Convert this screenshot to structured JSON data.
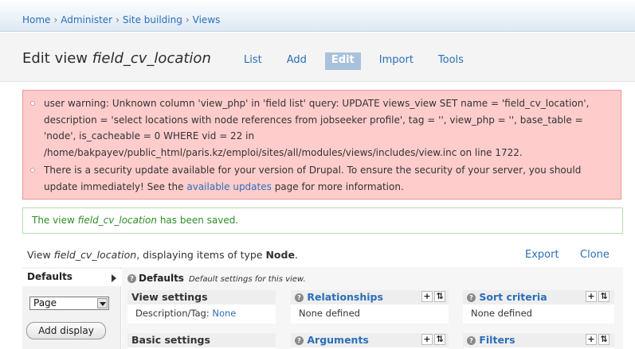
{
  "breadcrumb": [
    "Home",
    "Administer",
    "Site building",
    "Views"
  ],
  "breadcrumb_sep": "›",
  "header": {
    "title_prefix": "Edit view ",
    "title_view_name": "field_cv_location",
    "tabs": [
      "List",
      "Add",
      "Edit",
      "Import",
      "Tools"
    ],
    "active_tab": "Edit"
  },
  "errors": {
    "warning": "user warning: Unknown column 'view_php' in 'field list' query: UPDATE views_view SET name = 'field_cv_location', description = 'select locations with node references from jobseeker profile', tag = '', view_php = '', base_table = 'node', is_cacheable = 0 WHERE vid = 22 in /home/bakpayev/public_html/paris.kz/emploi/sites/all/modules/views/includes/view.inc on line 1722.",
    "security_pre": "There is a security update available for your version of Drupal. To ensure the security of your server, you should update immediately! See the ",
    "security_link": "available updates",
    "security_post": " page for more information."
  },
  "status": {
    "pre": "The view ",
    "view_name": "field_cv_location",
    "post": " has been saved."
  },
  "view_info": {
    "pre": "View ",
    "view_name": "field_cv_location",
    "mid": ", displaying items of type ",
    "type": "Node",
    "post": "."
  },
  "actions": {
    "export": "Export",
    "clone": "Clone"
  },
  "left": {
    "defaults_tab": "Defaults",
    "select_value": "Page",
    "add_display": "Add display"
  },
  "defaults_header": {
    "title": "Defaults",
    "desc": "Default settings for this view."
  },
  "panels": {
    "view_settings": {
      "title": "View settings",
      "desc_label": "Description/Tag: ",
      "desc_value": "None"
    },
    "relationships": {
      "title": "Relationships",
      "value": "None defined"
    },
    "sort": {
      "title": "Sort criteria",
      "value": "None defined"
    },
    "basic": {
      "title": "Basic settings"
    },
    "arguments": {
      "title": "Arguments"
    },
    "filters": {
      "title": "Filters"
    }
  },
  "icons": {
    "add": "+",
    "rearrange": "⇅",
    "help": "?"
  },
  "colors": {
    "error_bg": "#ffcccc",
    "status_text": "#2e8d26",
    "link": "#2b6fb6",
    "active_tab": "#a9c2db"
  }
}
